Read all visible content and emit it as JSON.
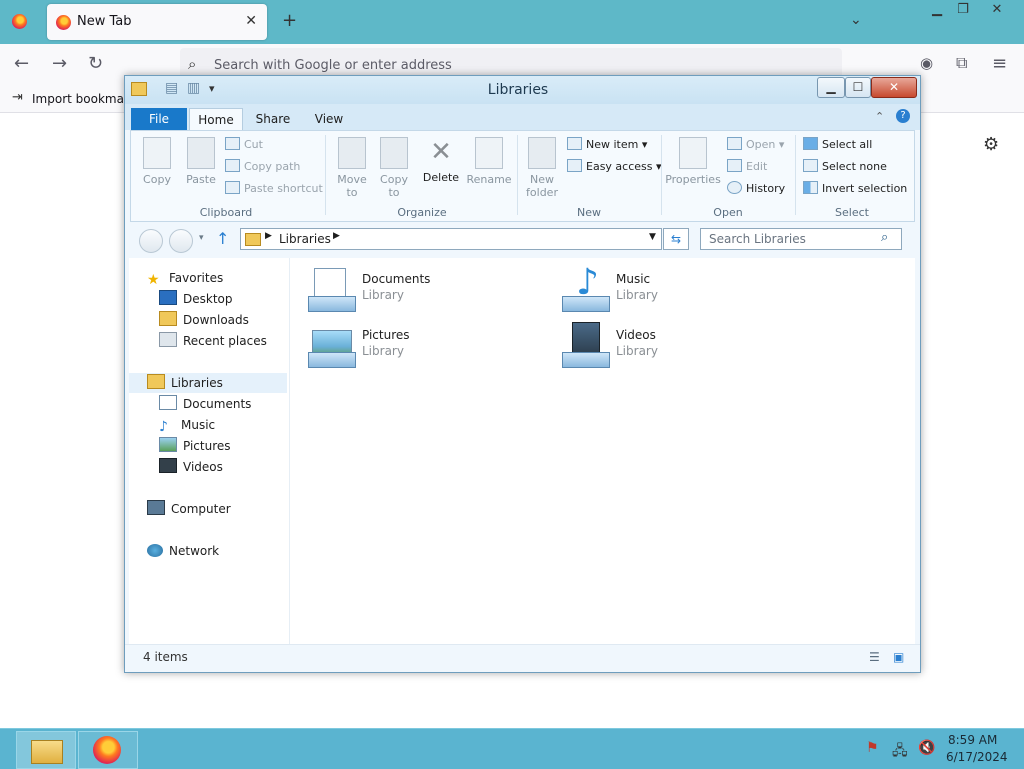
{
  "browser": {
    "tab_title": "New Tab",
    "url_placeholder": "Search with Google or enter address",
    "bookmark_label": "Import bookmark"
  },
  "explorer": {
    "title": "Libraries",
    "tabs": [
      "File",
      "Home",
      "Share",
      "View"
    ],
    "ribbon": {
      "clipboard": {
        "group": "Clipboard",
        "copy": "Copy",
        "paste": "Paste",
        "cut": "Cut",
        "copy_path": "Copy path",
        "paste_shortcut": "Paste shortcut"
      },
      "organize": {
        "group": "Organize",
        "move_to": "Move to",
        "copy_to": "Copy to",
        "delete": "Delete",
        "rename": "Rename"
      },
      "new": {
        "group": "New",
        "new_folder": "New folder",
        "new_item": "New item",
        "easy_access": "Easy access"
      },
      "open": {
        "group": "Open",
        "properties": "Properties",
        "open": "Open",
        "edit": "Edit",
        "history": "History"
      },
      "select": {
        "group": "Select",
        "select_all": "Select all",
        "select_none": "Select none",
        "invert": "Invert selection"
      }
    },
    "address": {
      "crumb": "Libraries",
      "search_placeholder": "Search Libraries"
    },
    "nav": {
      "favorites": "Favorites",
      "favorites_items": [
        "Desktop",
        "Downloads",
        "Recent places"
      ],
      "libraries": "Libraries",
      "libraries_items": [
        "Documents",
        "Music",
        "Pictures",
        "Videos"
      ],
      "computer": "Computer",
      "network": "Network"
    },
    "items": [
      {
        "name": "Documents",
        "type": "Library"
      },
      {
        "name": "Music",
        "type": "Library"
      },
      {
        "name": "Pictures",
        "type": "Library"
      },
      {
        "name": "Videos",
        "type": "Library"
      }
    ],
    "status": "4 items"
  },
  "taskbar": {
    "time": "8:59 AM",
    "date": "6/17/2024"
  }
}
